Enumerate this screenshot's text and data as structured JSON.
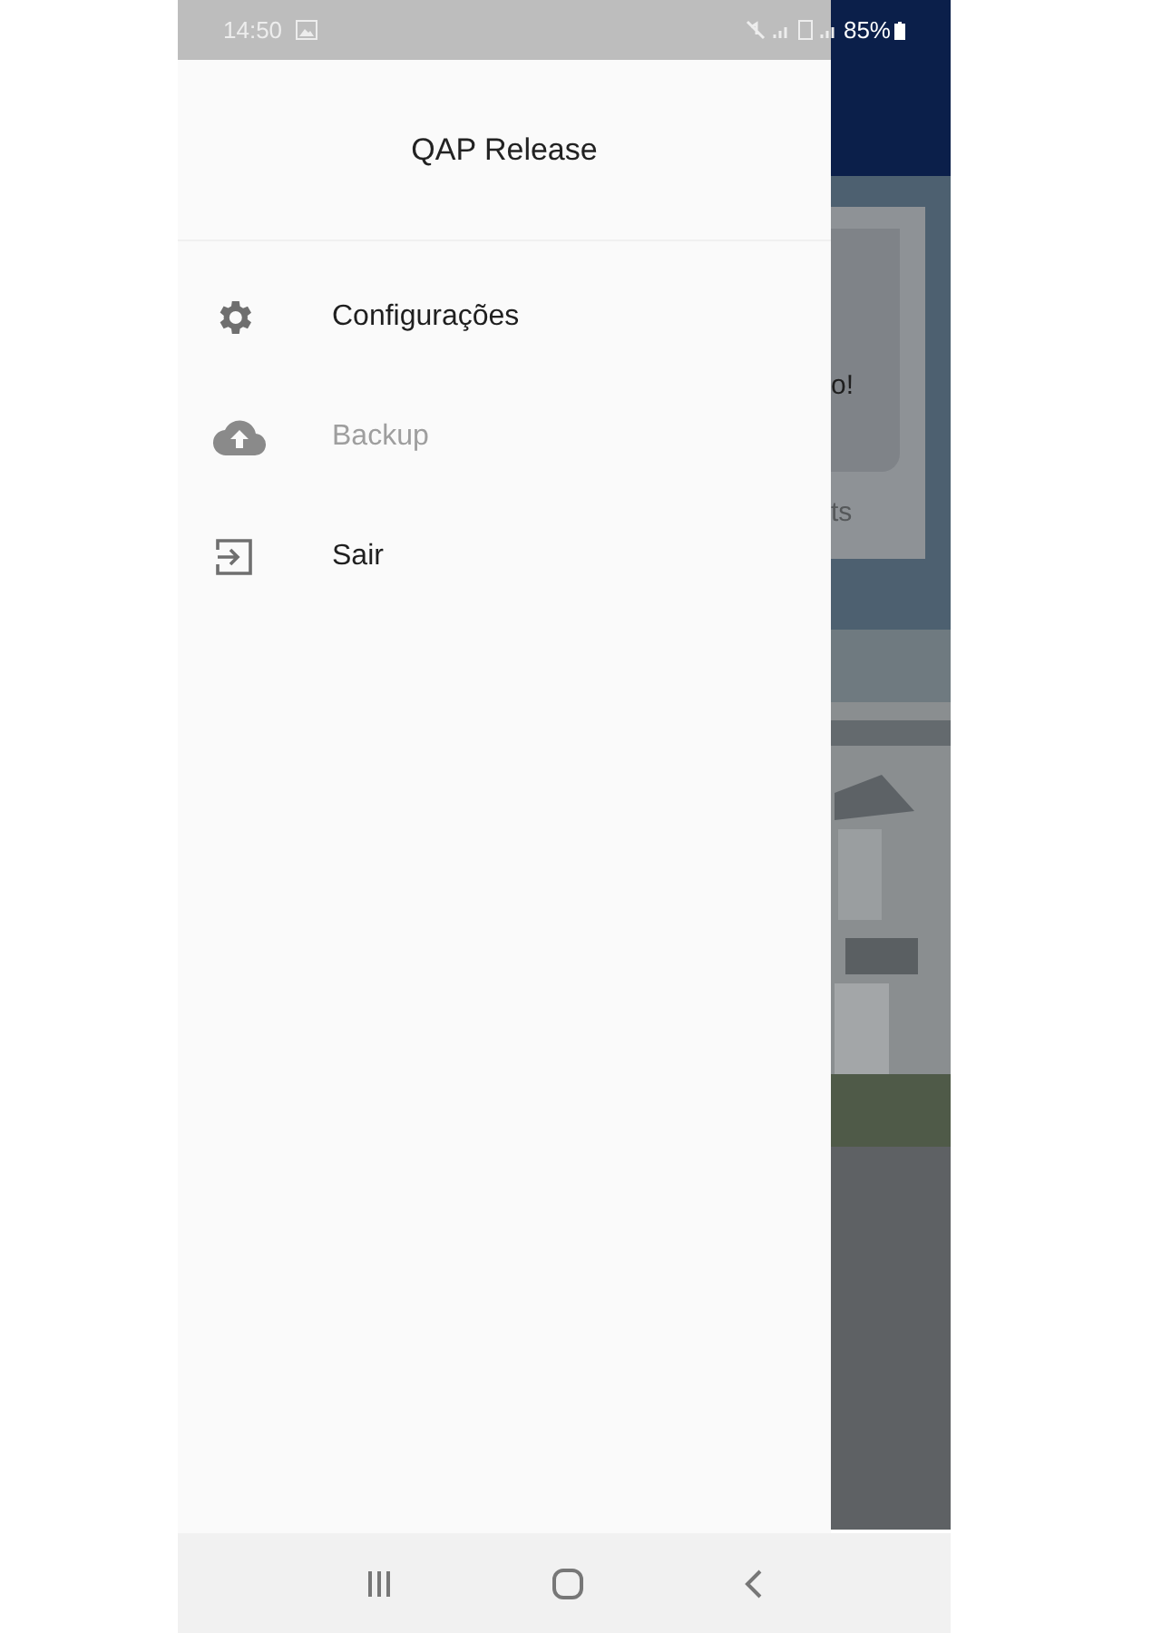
{
  "status_bar": {
    "time": "14:50",
    "battery": "85%"
  },
  "drawer": {
    "title": "QAP Release",
    "items": [
      {
        "kind": "settings",
        "label": "Configurações",
        "disabled": false
      },
      {
        "kind": "backup",
        "label": "Backup",
        "disabled": true
      },
      {
        "kind": "logout",
        "label": "Sair",
        "disabled": false
      }
    ]
  },
  "background_card": {
    "texts": [
      "o!",
      "ts"
    ]
  }
}
